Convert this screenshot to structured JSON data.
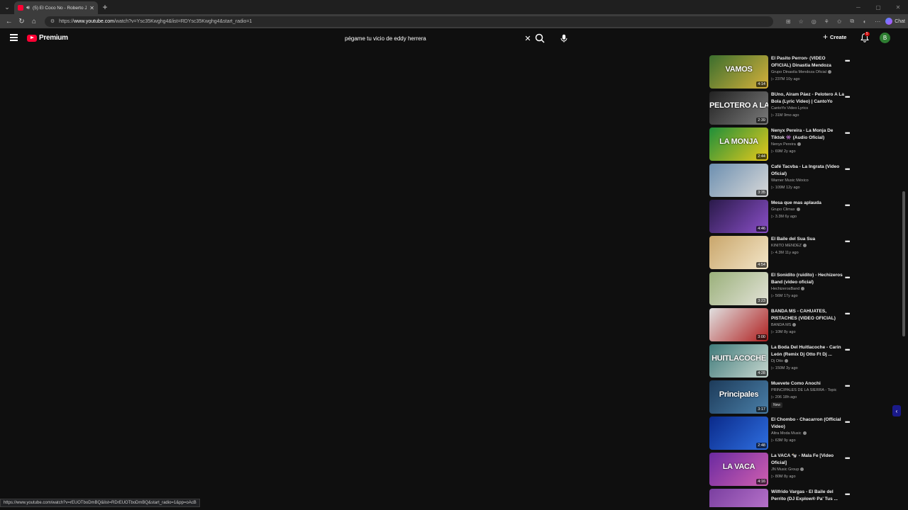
{
  "browser": {
    "tab_title": "(5) El Coco No - Roberto Junio",
    "url_prefix": "https://",
    "url_host": "www.youtube.com",
    "url_path": "/watch?v=Ysc35Kwghg4&list=RDYsc35Kwghg4&start_radio=1",
    "chat_label": "Chat"
  },
  "header": {
    "logo_text": "Premium",
    "search_value": "pégame tu vicio de eddy herrera",
    "create_label": "Create",
    "notification_count": "5",
    "avatar_letter": "B"
  },
  "recommendations": [
    {
      "title": "El Pasito Perron- (VIDEO OFICIAL) Dinastia Mendoza",
      "channel": "Grupo Dinastía Mendoza Oficial",
      "verified": true,
      "meta": "▷ 237M  10y ago",
      "duration": "4:14",
      "thumb_label": "VAMOS",
      "thumb_colors": [
        "#3b6e2e",
        "#d6b13b"
      ]
    },
    {
      "title": "BUno, Airam Páez - Pelotero A La Bola (Lyric Video) | CantoYo",
      "channel": "CantoYo Video Lyrics",
      "verified": false,
      "meta": "▷ 31M  9mo ago",
      "duration": "2:39",
      "thumb_label": "PELOTERO A LA BOLA",
      "thumb_colors": [
        "#222",
        "#7a7a7a"
      ]
    },
    {
      "title": "Nenyx Pereira - La Monja De Tiktok 👾 (Audio Oficial)",
      "channel": "Nenyx Pereira",
      "verified": true,
      "meta": "▷ 69M  2y ago",
      "duration": "2:44",
      "thumb_label": "LA MONJA",
      "thumb_colors": [
        "#1f8f3a",
        "#e8c91c"
      ]
    },
    {
      "title": "Café Tacvba - La Ingrata (Video Oficial)",
      "channel": "Warner Music México",
      "verified": false,
      "meta": "▷ 109M  12y ago",
      "duration": "3:35",
      "thumb_label": "",
      "thumb_colors": [
        "#6c8fb0",
        "#d9d9d9"
      ]
    },
    {
      "title": "Mesa que mas aplauda",
      "channel": "Grupo Climax",
      "verified": true,
      "meta": "▷ 3.3M  6y ago",
      "duration": "4:46",
      "thumb_label": "",
      "thumb_colors": [
        "#2a1a4a",
        "#8a4fc8"
      ]
    },
    {
      "title": "El Baile del Sua Sua",
      "channel": "KINITO MENDEZ",
      "verified": true,
      "meta": "▷ 4.3M  11y ago",
      "duration": "4:54",
      "thumb_label": "",
      "thumb_colors": [
        "#c9a66b",
        "#f3e6c8"
      ]
    },
    {
      "title": "El Sonidito (ruidito) - Hechizeros Band (video oficial)",
      "channel": "HechizerosBand",
      "verified": true,
      "meta": "▷ 56M  17y ago",
      "duration": "3:23",
      "thumb_label": "",
      "thumb_colors": [
        "#9ab07a",
        "#e3e3d8"
      ]
    },
    {
      "title": "BANDA MS - CAHUATES, PISTACHES (VIDEO OFICIAL)",
      "channel": "BANDA MS",
      "verified": true,
      "meta": "▷ 10M  8y ago",
      "duration": "3:00",
      "thumb_label": "",
      "thumb_colors": [
        "#e0e0e0",
        "#b02020"
      ]
    },
    {
      "title": "La Boda Del Huitlacoche - Carin León (Remix Dj Otto Ft Dj ...",
      "channel": "Dj Otto",
      "verified": true,
      "meta": "▷ 150M  3y ago",
      "duration": "4:28",
      "thumb_label": "HUITLACOCHE",
      "thumb_colors": [
        "#3f7a7a",
        "#c8d8d0"
      ]
    },
    {
      "title": "Muevete Como Anochi",
      "channel": "PRINCIPALES DE LA SIERRA - Topic",
      "verified": false,
      "meta": "▷ 206  18h ago",
      "badge": "New",
      "duration": "3:17",
      "thumb_label": "Principales",
      "thumb_colors": [
        "#1d3b5a",
        "#4a7fa8"
      ]
    },
    {
      "title": "El Chombo - Chacarron (Official Video)",
      "channel": "Altra Moda Music",
      "verified": true,
      "meta": "▷ 63M  9y ago",
      "duration": "2:48",
      "thumb_label": "",
      "thumb_colors": [
        "#0a2a8a",
        "#2f6fe0"
      ]
    },
    {
      "title": "La VACA 🐄 - Mala Fe [Video Oficial]",
      "channel": "JN Music Group",
      "verified": true,
      "meta": "▷ 80M  8y ago",
      "duration": "4:16",
      "thumb_label": "LA VACA",
      "thumb_colors": [
        "#6a2aa0",
        "#d05fb0"
      ]
    },
    {
      "title": "Wilfrido Vargas - El Baile del Perrito (DJ Explow® Pa' Tus ...",
      "channel": "",
      "verified": false,
      "meta": "",
      "duration": "",
      "thumb_label": "",
      "thumb_colors": [
        "#7a3fa0",
        "#c07ad0"
      ]
    }
  ],
  "status_bar_url": "https://www.youtube.com/watch?v=rEUOTboDmBQ&list=RDrEUOTboDmBQ&start_radio=1&pp=oAcB"
}
